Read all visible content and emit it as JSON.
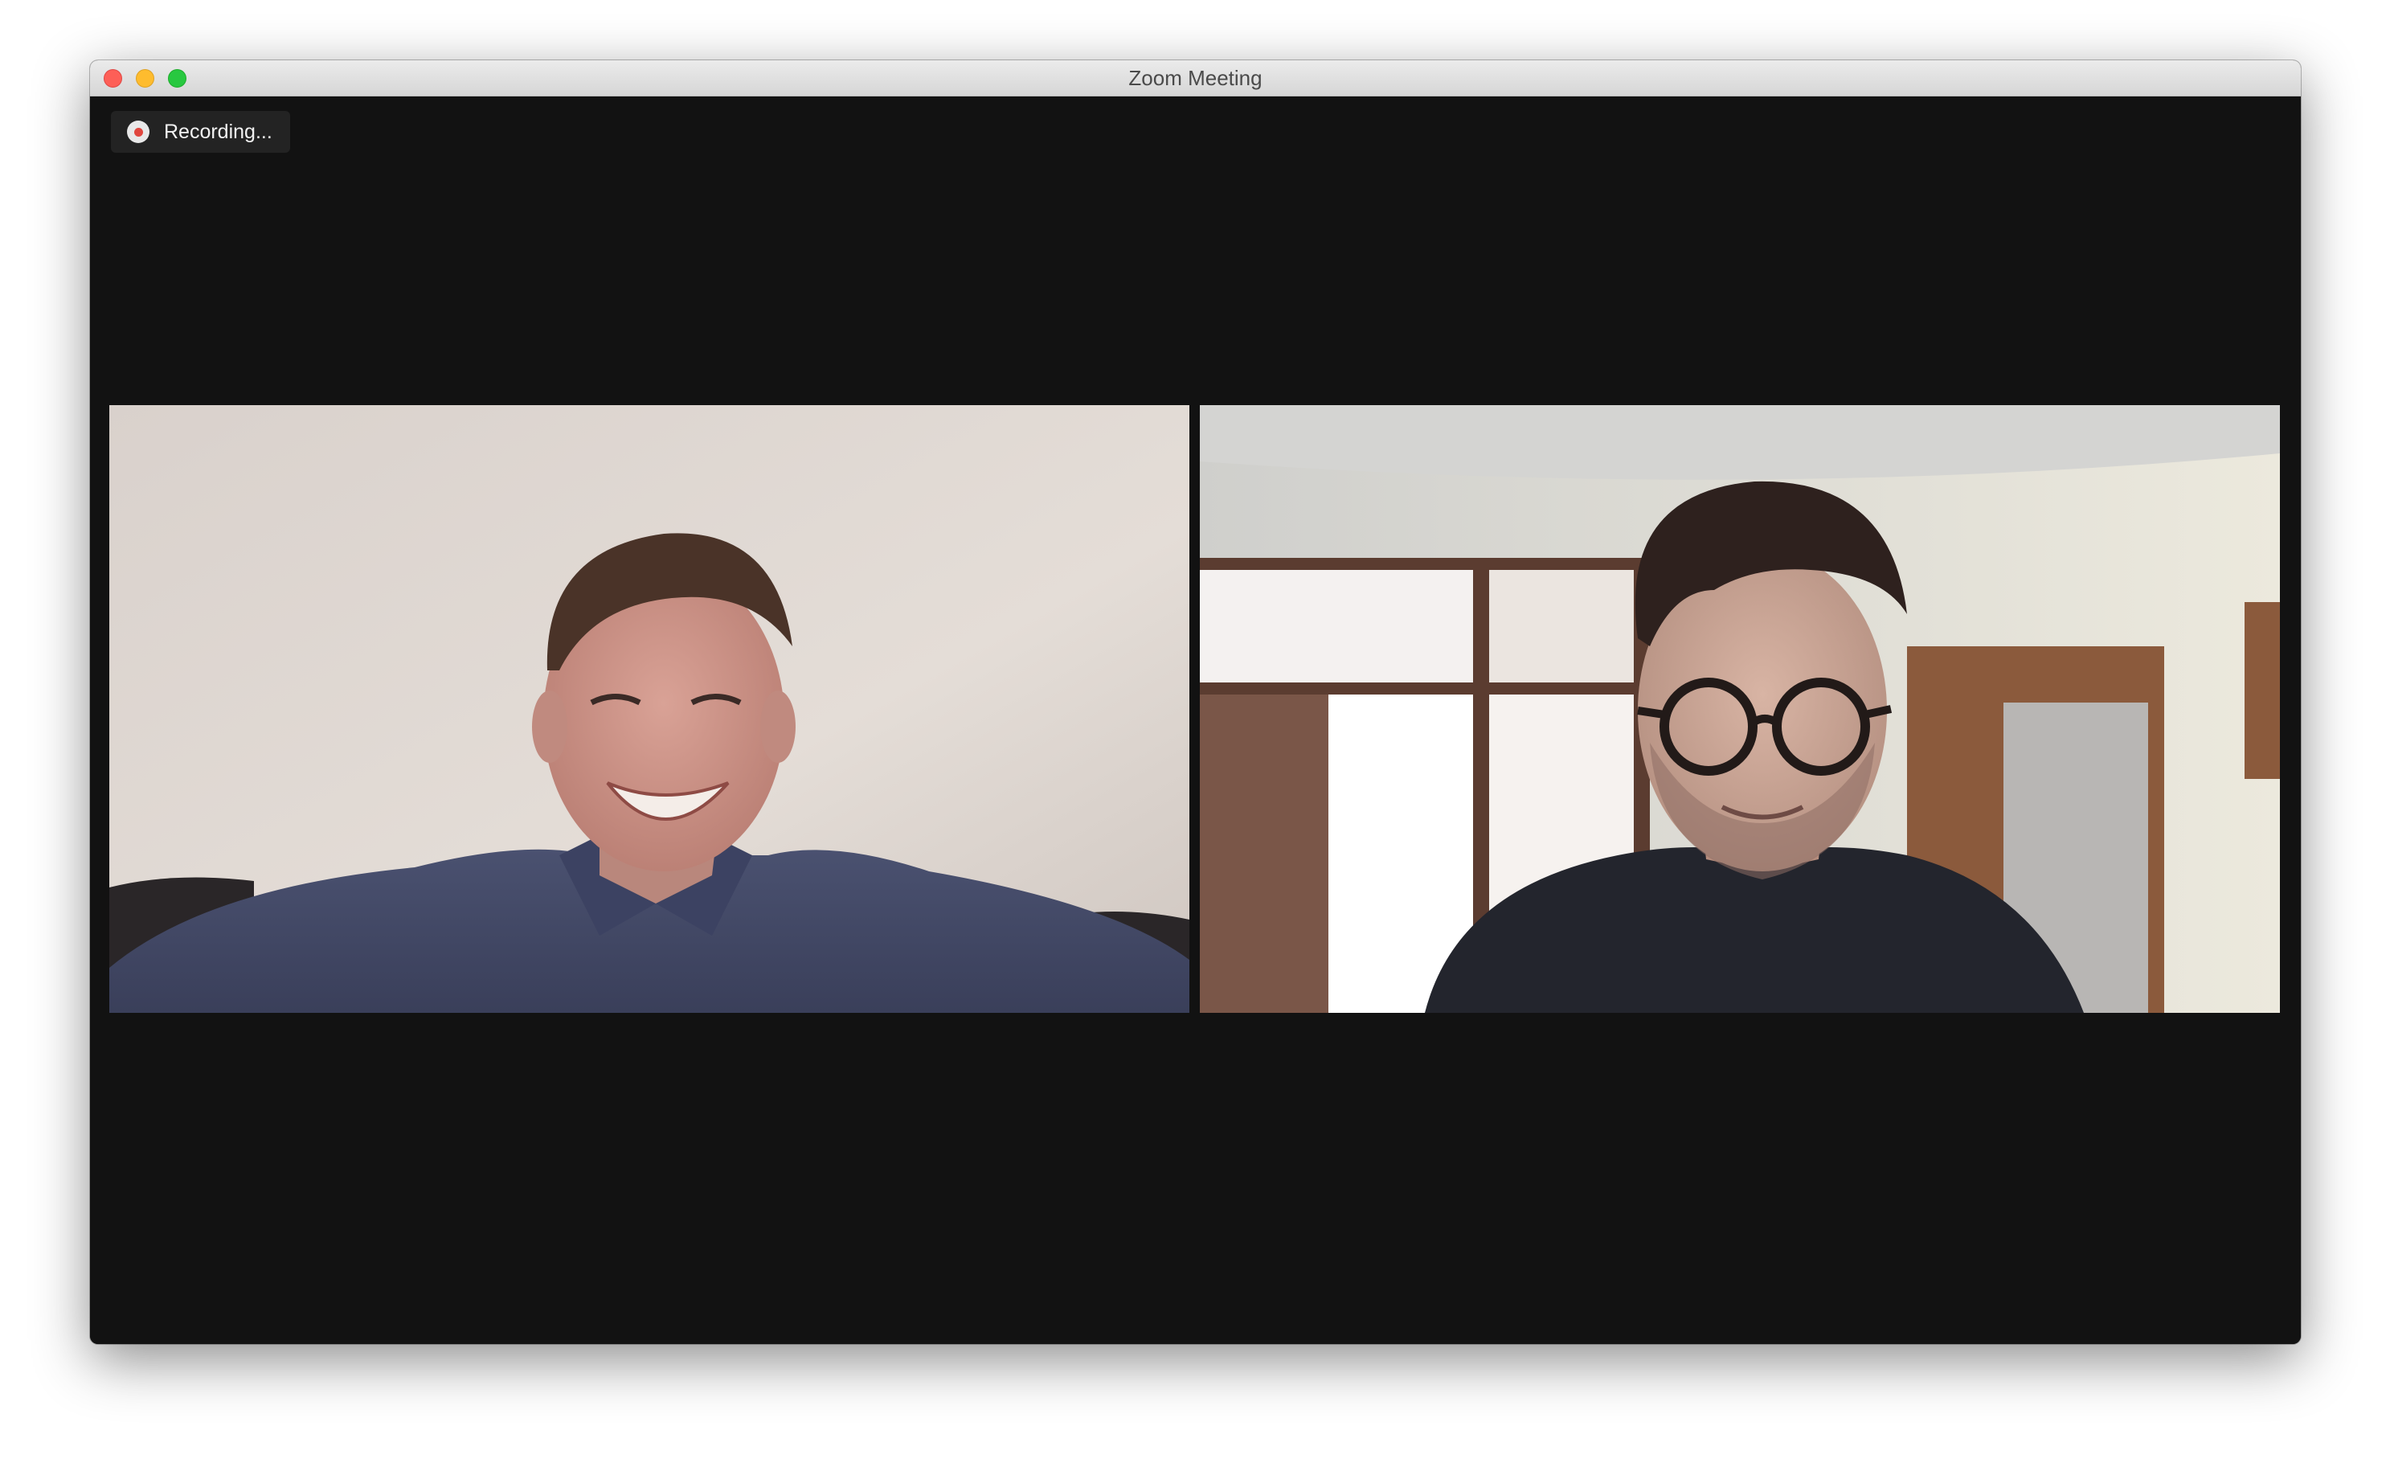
{
  "window": {
    "title": "Zoom Meeting"
  },
  "recording": {
    "label": "Recording..."
  },
  "participants": [
    {
      "tile": "left"
    },
    {
      "tile": "right"
    }
  ],
  "colors": {
    "background": "#121212",
    "recording_dot": "#e0463e",
    "traffic_close": "#fd5f57",
    "traffic_minimize": "#febc2e",
    "traffic_maximize": "#28c840"
  }
}
